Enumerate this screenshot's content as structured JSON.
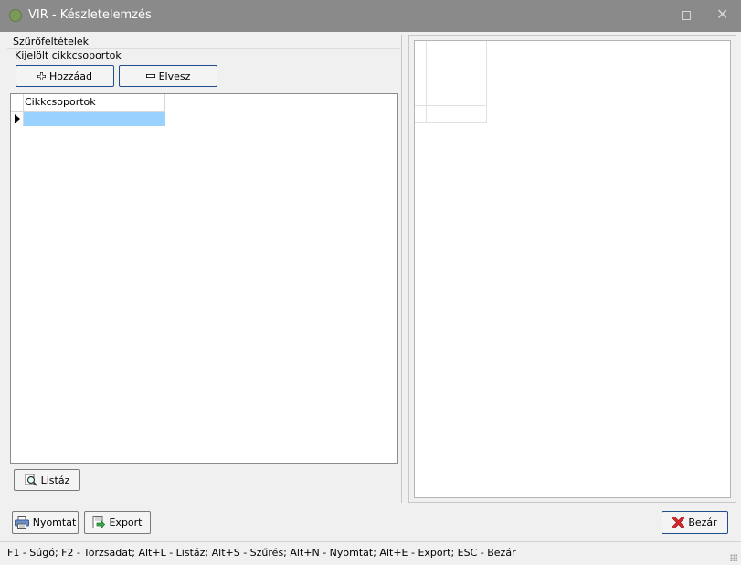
{
  "window": {
    "title": "VIR - Készletelemzés"
  },
  "filter": {
    "section_label": "Szűrőfeltételek",
    "group_label": "Kijelölt cikkcsoportok",
    "add_button": "Hozzáad",
    "remove_button": "Elvesz",
    "grid": {
      "columns": [
        "Cikkcsoportok"
      ],
      "rows": [
        ""
      ]
    },
    "list_button": "Listáz"
  },
  "bottom": {
    "print_button": "Nyomtat",
    "export_button": "Export",
    "close_button": "Bezár"
  },
  "statusbar": {
    "text": "F1 - Súgó; F2 - Törzsadat; Alt+L - Listáz; Alt+S - Szűrés; Alt+N - Nyomtat; Alt+E - Export; ESC - Bezár"
  },
  "icons": {
    "app": "app-icon",
    "add": "plus-icon",
    "remove": "minus-icon",
    "list": "magnifier-icon",
    "print": "printer-icon",
    "export": "export-icon",
    "close": "red-x-icon"
  },
  "colors": {
    "titlebar": "#8a8a8a",
    "selection": "#99d1ff",
    "button_border": "#1f4e8c",
    "close_icon": "#d9262c"
  }
}
